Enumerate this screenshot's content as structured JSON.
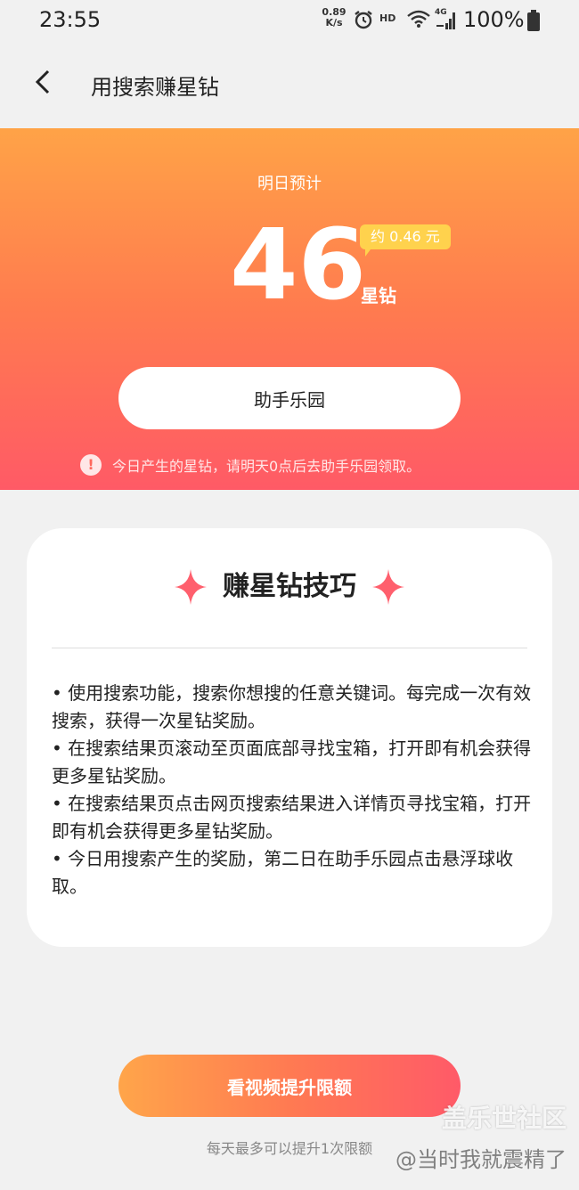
{
  "status_bar": {
    "time": "23:55",
    "net_speed_value": "0.89",
    "net_speed_unit": "K/s",
    "hd": "HD",
    "network": "4G",
    "battery": "100%",
    "icons": [
      "alarm-icon",
      "wifi-icon",
      "signal-icon",
      "battery-icon"
    ]
  },
  "header": {
    "title": "用搜索赚星钻",
    "back_icon": "chevron-left-icon"
  },
  "hero": {
    "label": "明日预计",
    "amount": "46",
    "approx_value": "约 0.46 元",
    "unit": "星钻",
    "button_label": "助手乐园",
    "notice_icon": "!",
    "notice": "今日产生的星钻，请明天0点后去助手乐园领取。"
  },
  "tips_card": {
    "title": "赚星钻技巧",
    "items": [
      "• 使用搜索功能，搜索你想搜的任意关键词。每完成一次有效搜索，获得一次星钻奖励。",
      "• 在搜索结果页滚动至页面底部寻找宝箱，打开即有机会获得更多星钻奖励。",
      "• 在搜索结果页点击网页搜索结果进入详情页寻找宝箱，打开即有机会获得更多星钻奖励。",
      "• 今日用搜索产生的奖励，第二日在助手乐园点击悬浮球收取。"
    ]
  },
  "footer": {
    "cta_label": "看视频提升限额",
    "cta_note": "每天最多可以提升1次限额"
  },
  "watermark": {
    "site": "盖乐世社区",
    "user": "@当时我就震精了"
  },
  "colors": {
    "gradient_top": "#ffa347",
    "gradient_bottom": "#ff5a66",
    "approx_badge": "#ffd24d",
    "sparkle": "#ff5f6d"
  }
}
